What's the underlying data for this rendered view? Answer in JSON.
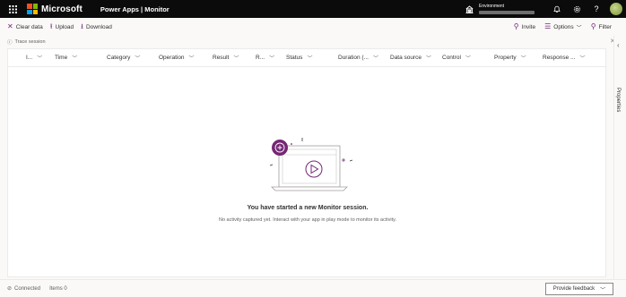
{
  "topbar": {
    "brand": "Microsoft",
    "app_title": "Power Apps | Monitor",
    "environment_label": "Environment",
    "icons": [
      "waffle-icon",
      "environment-icon",
      "bell-icon",
      "gear-icon",
      "help-icon",
      "avatar"
    ]
  },
  "commands": {
    "clear_data": "Clear data",
    "upload": "Upload",
    "download": "Download",
    "invite": "Invite",
    "options": "Options",
    "filter": "Filter"
  },
  "trace": {
    "label": "Trace session"
  },
  "grid": {
    "columns": [
      "I...",
      "Time",
      "Category",
      "Operation",
      "Result",
      "R...",
      "Status",
      "Duration (...",
      "Data source",
      "Control",
      "Property",
      "Response ..."
    ]
  },
  "empty_state": {
    "title": "You have started a new Monitor session.",
    "subtitle": "No activity captured yet. Interact with your app in play mode to monitor its activity."
  },
  "rail": {
    "label": "Properties"
  },
  "status": {
    "connection": "Connected",
    "items": "Items 0",
    "feedback": "Provide feedback"
  },
  "colors": {
    "accent": "#742774",
    "topbar": "#0b0b0b",
    "ms_red": "#f25022",
    "ms_green": "#7fba00",
    "ms_blue": "#00a4ef",
    "ms_yellow": "#ffb900"
  }
}
